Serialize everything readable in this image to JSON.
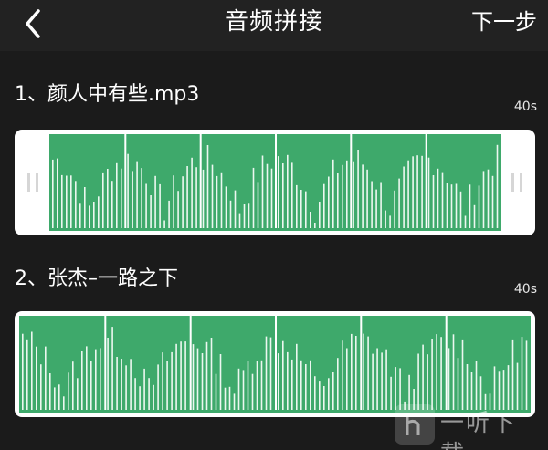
{
  "header": {
    "title": "音频拼接",
    "next_label": "下一步"
  },
  "tracks": [
    {
      "name": "1、颜人中有些.mp3",
      "duration": "40s",
      "selected": false,
      "segment_count": 6
    },
    {
      "name": "2、张杰–一路之下",
      "duration": "40s",
      "selected": true,
      "segment_count": 6
    }
  ],
  "colors": {
    "background": "#1b1b1b",
    "header": "#222222",
    "waveform_fill": "#3ea96b",
    "waveform_bar": "#ffffff",
    "card": "#ffffff"
  },
  "icons": {
    "back": "chevron-left-icon",
    "watermark_logo": "yiting-logo-icon"
  },
  "watermark": {
    "text": "一听下载"
  }
}
